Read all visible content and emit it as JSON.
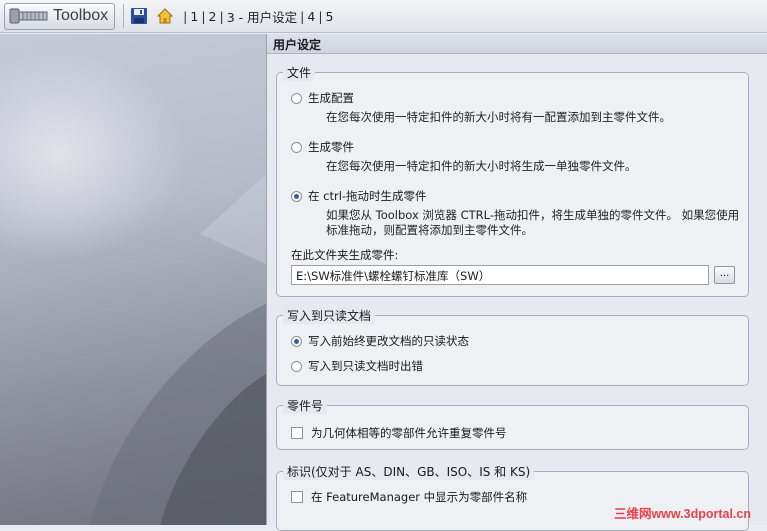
{
  "toolbar": {
    "logo_text": "Toolbox",
    "breadcrumbs": [
      "1",
      "2",
      "3 - 用户设定",
      "4",
      "5"
    ],
    "icons": [
      "bolt-icon",
      "save-icon",
      "home-icon"
    ]
  },
  "panel": {
    "title": "用户设定",
    "file_group": {
      "legend": "文件",
      "options": [
        {
          "label": "生成配置",
          "desc": "在您每次使用一特定扣件的新大小时将有一配置添加到主零件文件。",
          "selected": false
        },
        {
          "label": "生成零件",
          "desc": "在您每次使用一特定扣件的新大小时将生成一单独零件文件。",
          "selected": false
        },
        {
          "label": "在 ctrl-拖动时生成零件",
          "desc": "如果您从 Toolbox 浏览器 CTRL-拖动扣件，将生成单独的零件文件。 如果您使用标准拖动，则配置将添加到主零件文件。",
          "selected": true
        }
      ],
      "folder_label": "在此文件夹生成零件:",
      "folder_value": "E:\\SW标准件\\螺栓螺钉标准库（SW）",
      "browse_label": "..."
    },
    "readonly_group": {
      "legend": "写入到只读文档",
      "options": [
        {
          "label": "写入前始终更改文档的只读状态",
          "selected": true
        },
        {
          "label": "写入到只读文档时出错",
          "selected": false
        }
      ]
    },
    "partnum_group": {
      "legend": "零件号",
      "check_label": "为几何体相等的零部件允许重复零件号",
      "checked": false
    },
    "mark_group": {
      "legend": "标识(仅对于 AS、DIN、GB、ISO、IS 和 KS)",
      "check_label": "在 FeatureManager 中显示为零部件名称",
      "checked": false
    }
  },
  "watermark": "三维网www.3dportal.cn",
  "colors": {
    "accent": "#2f5fa8",
    "watermark": "#e8424a"
  }
}
